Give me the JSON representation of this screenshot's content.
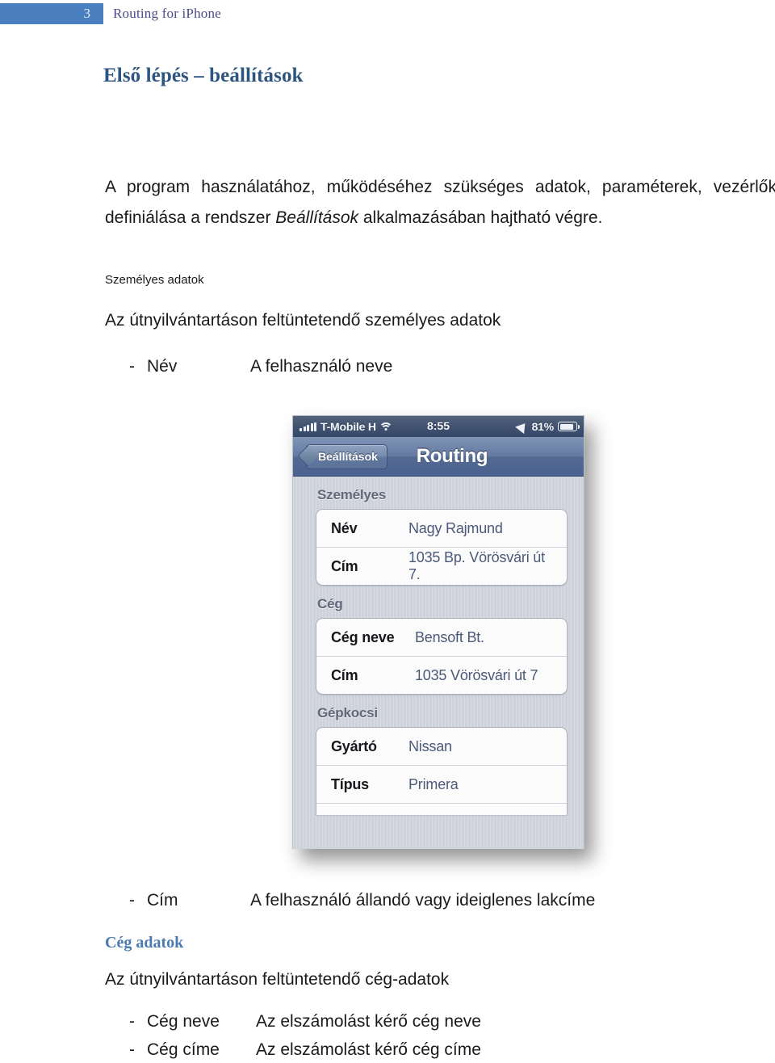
{
  "header": {
    "page_number": "3",
    "document_title": "Routing for iPhone"
  },
  "section_title": "Első lépés – beállítások",
  "body_paragraph": {
    "part1": "A program használatához, működéséhez szükséges adatok, paraméterek, vezérlők definiálása a rendszer ",
    "emphasis": "Beállítások",
    "part2": " alkalmazásában hajtható végre."
  },
  "personal_section": {
    "small_label": "Személyes adatok",
    "lead": "Az útnyilvántartáson feltüntetendő személyes adatok",
    "items": [
      {
        "dash": "-",
        "term": "Név",
        "desc": "A felhasználó neve"
      },
      {
        "dash": "-",
        "term": "Cím",
        "desc": "A felhasználó állandó vagy ideiglenes lakcíme"
      }
    ]
  },
  "company_section": {
    "heading": "Cég adatok",
    "lead": "Az útnyilvántartáson feltüntetendő cég-adatok",
    "items": [
      {
        "dash": "-",
        "term": "Cég neve",
        "desc": "Az elszámolást kérő cég neve"
      },
      {
        "dash": "-",
        "term": "Cég címe",
        "desc": "Az elszámolást kérő cég címe"
      }
    ]
  },
  "phone_screenshot": {
    "status_bar": {
      "signal_icon": "signal-bars-icon",
      "carrier": "T-Mobile H",
      "wifi_icon": "wifi-icon",
      "time": "8:55",
      "location_icon": "location-arrow-icon",
      "battery_percent": "81%",
      "battery_icon": "battery-icon"
    },
    "nav_bar": {
      "back_label": "Beállítások",
      "title": "Routing"
    },
    "groups": [
      {
        "header": "Személyes",
        "rows": [
          {
            "label": "Név",
            "value": "Nagy Rajmund"
          },
          {
            "label": "Cím",
            "value": "1035 Bp. Vörösvári út 7."
          }
        ]
      },
      {
        "header": "Cég",
        "rows": [
          {
            "label": "Cég neve",
            "value": "Bensoft Bt."
          },
          {
            "label": "Cím",
            "value": "1035 Vörösvári út 7"
          }
        ]
      },
      {
        "header": "Gépkocsi",
        "rows": [
          {
            "label": "Gyártó",
            "value": "Nissan"
          },
          {
            "label": "Típus",
            "value": "Primera"
          }
        ]
      }
    ]
  },
  "colors": {
    "header_box_blue": "#4a80c0",
    "header_title_purple": "#4a4a8a",
    "section_title_blue": "#2d5580",
    "subhead_blue": "#4a7ab0",
    "ios_nav_blue": "#63799f",
    "ios_value_blue": "#4a5a78"
  }
}
